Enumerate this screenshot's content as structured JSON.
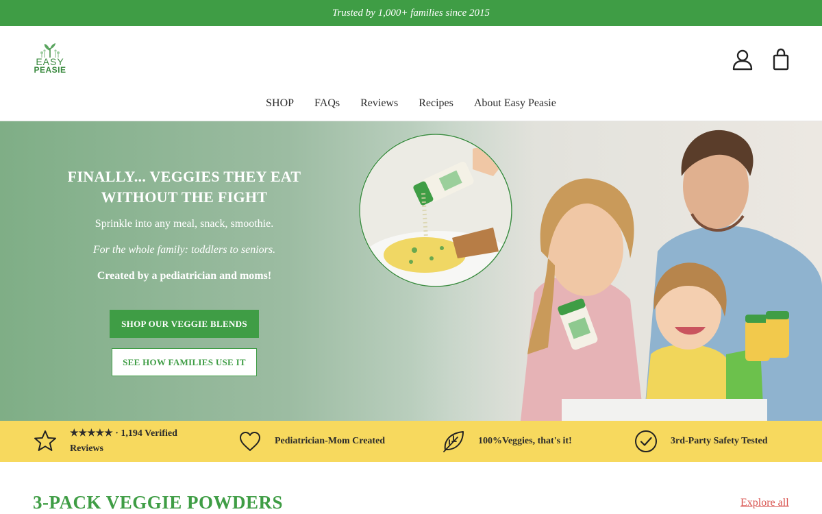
{
  "announcement": "Trusted by 1,000+ families since 2015",
  "logo": {
    "line1": "EASY",
    "line2": "PEASIE"
  },
  "header_icons": [
    "account-icon",
    "cart-icon"
  ],
  "nav": [
    "SHOP",
    "FAQs",
    "Reviews",
    "Recipes",
    "About Easy Peasie"
  ],
  "hero": {
    "title": "FINALLY... VEGGIES THEY EAT WITHOUT THE FIGHT",
    "line1": "Sprinkle into any meal, snack, smoothie.",
    "line2": "For the whole family: toddlers to seniors.",
    "line3": "Created by a pediatrician and moms!",
    "primary_cta": "SHOP OUR VEGGIE BLENDS",
    "secondary_cta": "SEE HOW FAMILIES USE IT"
  },
  "trust": [
    {
      "icon": "star-icon",
      "text": "★★★★★ · 1,194 Verified Reviews"
    },
    {
      "icon": "heart-icon",
      "text": "Pediatrician-Mom Created"
    },
    {
      "icon": "leaf-icon",
      "text": "100%Veggies, that's it!"
    },
    {
      "icon": "check-circle-icon",
      "text": "3rd-Party Safety Tested"
    }
  ],
  "section": {
    "title": "3-PACK VEGGIE POWDERS",
    "link": "Explore all"
  },
  "colors": {
    "brand_green": "#3f9d45",
    "trust_bar": "#f7d95e",
    "link_red": "#d9534f"
  }
}
